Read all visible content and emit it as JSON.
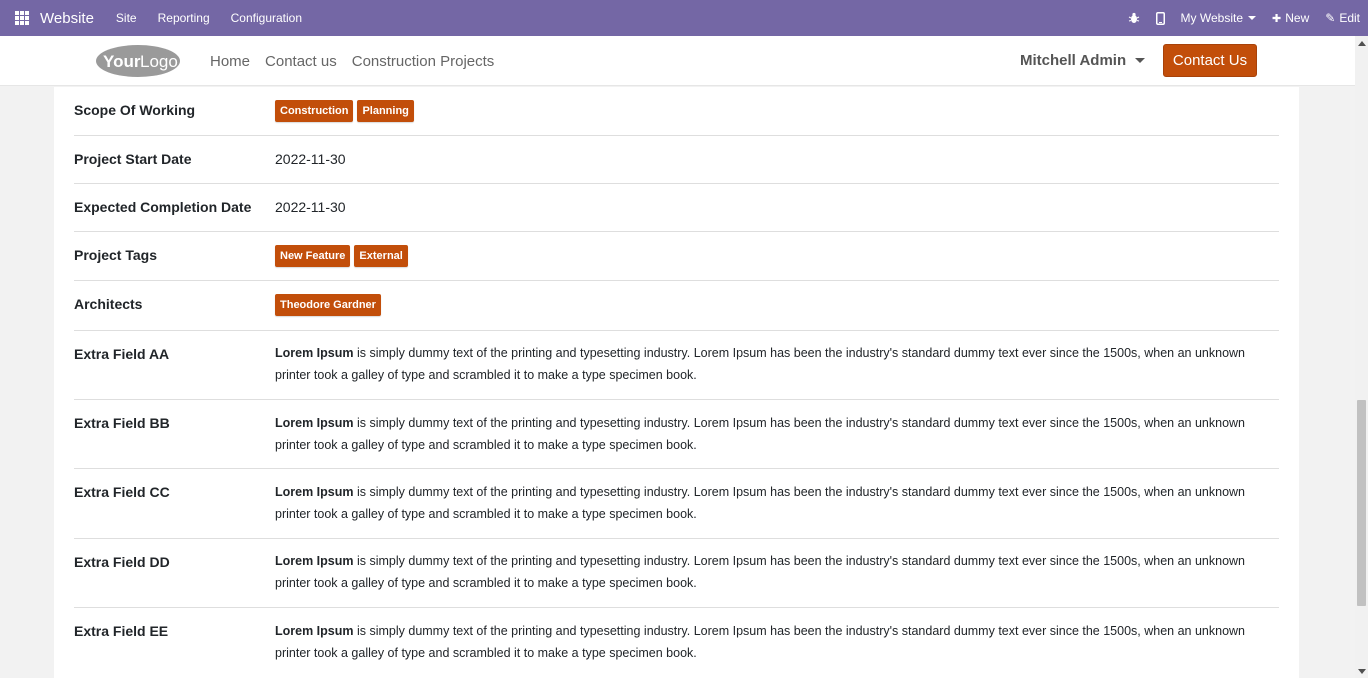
{
  "topbar": {
    "brand": "Website",
    "menus": [
      "Site",
      "Reporting",
      "Configuration"
    ],
    "website_selector": "My Website",
    "new_label": "New",
    "edit_label": "Edit",
    "plus_glyph": "✚",
    "edit_glyph": "✎"
  },
  "header": {
    "logo_text": "YourLogo",
    "logo_your": "Your",
    "logo_logo": "Logo",
    "nav": [
      "Home",
      "Contact us",
      "Construction Projects"
    ],
    "user": "Mitchell Admin",
    "contact_button": "Contact Us"
  },
  "fields": {
    "scope": {
      "label": "Scope Of Working",
      "tags": [
        "Construction",
        "Planning"
      ]
    },
    "start_date": {
      "label": "Project Start Date",
      "value": "2022-11-30"
    },
    "completion_date": {
      "label": "Expected Completion Date",
      "value": "2022-11-30"
    },
    "project_tags": {
      "label": "Project Tags",
      "tags": [
        "New Feature",
        "External"
      ]
    },
    "architects": {
      "label": "Architects",
      "tags": [
        "Theodore Gardner"
      ]
    },
    "lorem_bold": "Lorem Ipsum",
    "lorem_line1": " is simply dummy text of the printing and typesetting industry. Lorem Ipsum has been the industry's standard dummy text ever since the 1500s, when an unknown",
    "lorem_line2": "printer took a galley of type and scrambled it to make a type specimen book.",
    "extra": [
      {
        "label": "Extra Field AA"
      },
      {
        "label": "Extra Field BB"
      },
      {
        "label": "Extra Field CC"
      },
      {
        "label": "Extra Field DD"
      },
      {
        "label": "Extra Field EE"
      }
    ]
  },
  "colors": {
    "odoo_bar": "#7467a5",
    "accent": "#c24e0a"
  }
}
